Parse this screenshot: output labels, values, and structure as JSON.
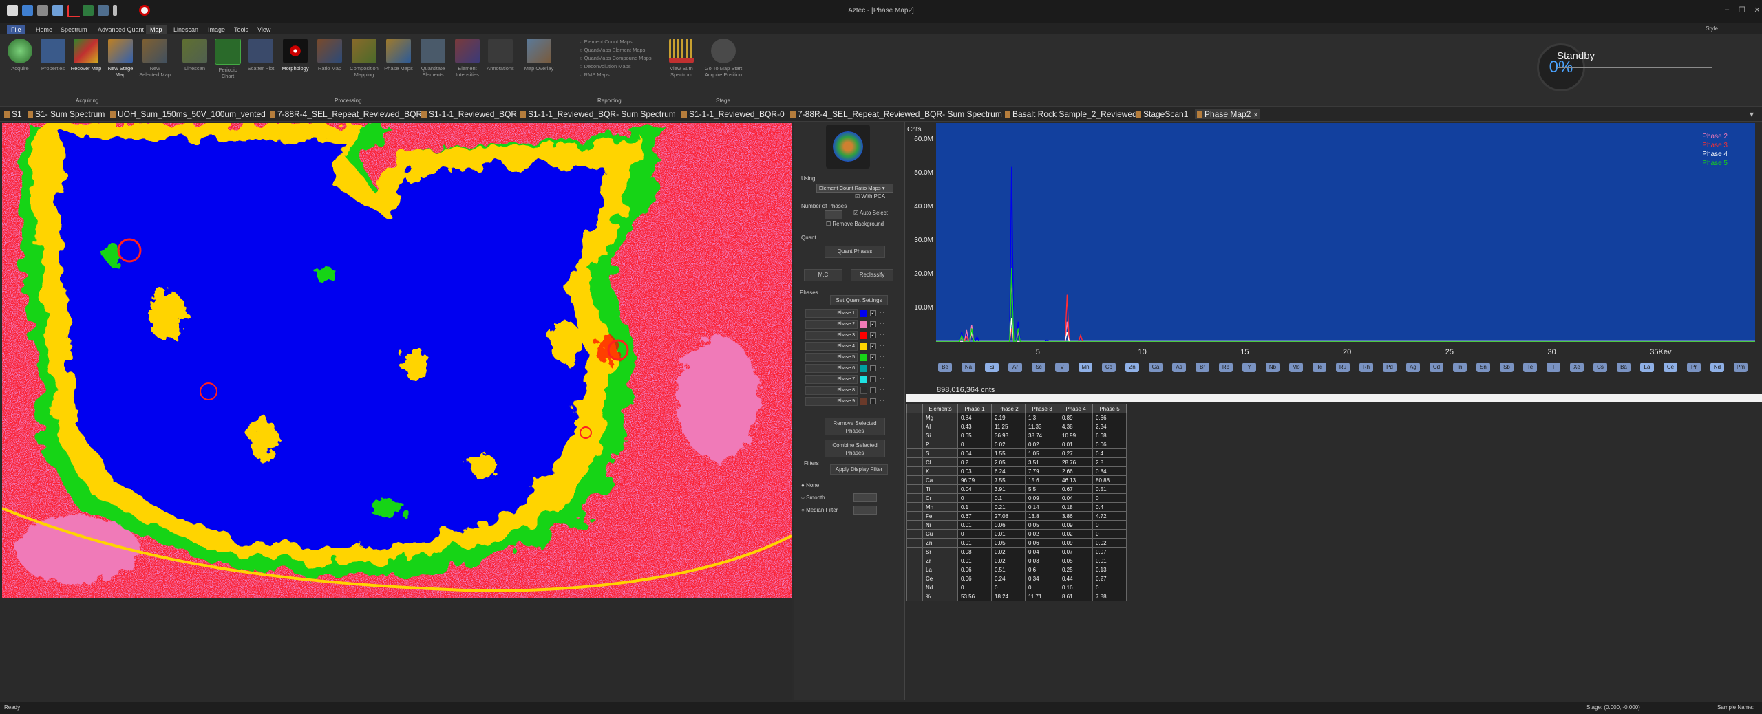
{
  "window": {
    "title": "Aztec - [Phase Map2]"
  },
  "menu": {
    "tabs": [
      "File",
      "Home",
      "Spectrum",
      "Advanced Quant",
      "Map",
      "Linescan",
      "Image",
      "Tools",
      "View"
    ],
    "active": "Map",
    "style_label": "Style"
  },
  "ribbon": {
    "groups": {
      "acquiring": "Acquiring",
      "processing": "Processing",
      "reporting": "Reporting",
      "stage": "Stage"
    },
    "buttons": [
      "Acquire",
      "Properties",
      "Recover Map",
      "New Stage Map",
      "New Selected Map",
      "Linescan",
      "Periodic Chart",
      "Scatter Plot",
      "Morphology",
      "Ratio Map",
      "Composition Mapping",
      "Phase Maps",
      "Quantitate Elements",
      "Element Intensities",
      "Annotations",
      "Map Overlay",
      "View Sum Spectrum",
      "Go To Map Start Acquire Position"
    ],
    "reporting_options": [
      "Element Count Maps",
      "QuantMaps Element Maps",
      "QuantMaps Compound Maps",
      "Deconvolution Maps",
      "RMS Maps"
    ]
  },
  "progress": {
    "percent": "0%",
    "status": "Standby"
  },
  "doc_tabs": [
    "S1",
    "S1- Sum Spectrum",
    "UOH_Sum_150ms_50V_100um_vented",
    "7-88R-4_SEL_Repeat_Reviewed_BQR",
    "S1-1-1_Reviewed_BQR",
    "S1-1-1_Reviewed_BQR- Sum Spectrum",
    "S1-1-1_Reviewed_BQR-0",
    "7-88R-4_SEL_Repeat_Reviewed_BQR- Sum Spectrum",
    "Basalt Rock Sample_2_Reviewed",
    "StageScan1",
    "Phase Map2"
  ],
  "active_doc_tab": "Phase Map2",
  "colors": {
    "phase1": "#0000f0",
    "phase2": "#f07ab8",
    "phase3": "#ff0000",
    "phase4": "#ffd400",
    "phase5": "#18d418",
    "phase6": "#00c8c8",
    "spectrum_bg": "#12409e"
  },
  "panel": {
    "using_label": "Using",
    "using_value": "Element Count Ratio Maps",
    "with_pca": "With PCA",
    "num_phases_label": "Number of Phases",
    "auto_select": "Auto Select",
    "remove_background": "Remove Background",
    "quant_label": "Quant",
    "quant_phases": "Quant Phases",
    "mc": "M.C",
    "reclassify": "Reclassify",
    "phases_label": "Phases",
    "set_quant_settings": "Set Quant Settings",
    "phases": [
      {
        "name": "Phase 1",
        "checked": "✓",
        "color": "#0000f0"
      },
      {
        "name": "Phase 2",
        "checked": "✓",
        "color": "#f07ab8"
      },
      {
        "name": "Phase 3",
        "checked": "✓",
        "color": "#ff0000"
      },
      {
        "name": "Phase 4",
        "checked": "✓",
        "color": "#ffd400"
      },
      {
        "name": "Phase 5",
        "checked": "✓",
        "color": "#18d418"
      },
      {
        "name": "Phase 6",
        "checked": "",
        "color": "#00a0a0"
      },
      {
        "name": "Phase 7",
        "checked": "",
        "color": "#1ee0e0"
      },
      {
        "name": "Phase 8",
        "checked": "",
        "color": "#2a2a2a"
      },
      {
        "name": "Phase 9",
        "checked": "",
        "color": "#6a3a2a"
      }
    ],
    "remove_selected": "Remove Selected Phases",
    "combine_selected": "Combine Selected Phases",
    "filters_label": "Filters",
    "apply_display_filter": "Apply Display Filter",
    "filter_none": "None",
    "filter_smooth": "Smooth",
    "filter_median": "Median Filter"
  },
  "spectrum": {
    "y_unit": "Cnts",
    "y_ticks": [
      "60.0M",
      "50.0M",
      "40.0M",
      "30.0M",
      "20.0M",
      "10.0M"
    ],
    "x_ticks": [
      "5",
      "10",
      "15",
      "20",
      "25",
      "30",
      "35Kev"
    ],
    "legend": [
      {
        "name": "Phase 2",
        "color": "#f07ab8"
      },
      {
        "name": "Phase 3",
        "color": "#ff3030"
      },
      {
        "name": "Phase 4",
        "color": "#ffffff"
      },
      {
        "name": "Phase 5",
        "color": "#18d418"
      }
    ],
    "elements": [
      "Be",
      "Na",
      "Si",
      "Ar",
      "Sc",
      "V",
      "Mn",
      "Co",
      "Zn",
      "Ga",
      "As",
      "Br",
      "Rb",
      "Y",
      "Nb",
      "Mo",
      "Tc",
      "Ru",
      "Rh",
      "Pd",
      "Ag",
      "Cd",
      "In",
      "Sn",
      "Sb",
      "Te",
      "I",
      "Xe",
      "Cs",
      "Ba",
      "La",
      "Ce",
      "Pr",
      "Nd",
      "Pm"
    ],
    "selected_elements": [
      "Si",
      "Mn",
      "Zn",
      "La",
      "Ce",
      "Nd"
    ],
    "counts": "898,016,364 cnts"
  },
  "chart_data": {
    "type": "line",
    "xlabel": "Kev",
    "ylabel": "Cnts",
    "xlim": [
      0,
      40
    ],
    "ylim": [
      0,
      65000000
    ],
    "series": [
      {
        "name": "Phase 1",
        "color": "#0000f0",
        "x": [
          1.25,
          1.49,
          1.74,
          2.0,
          3.69,
          4.01,
          5.41,
          6.4,
          7.06
        ],
        "y": [
          3000000,
          2000000,
          3000000,
          1500000,
          52000000,
          6000000,
          500000,
          14000000,
          1500000
        ]
      },
      {
        "name": "Phase 2",
        "color": "#f07ab8",
        "x": [
          1.25,
          1.49,
          1.74,
          3.69,
          4.01,
          6.4
        ],
        "y": [
          1500000,
          3500000,
          5000000,
          20000000,
          3000000,
          6000000
        ]
      },
      {
        "name": "Phase 3",
        "color": "#ff3030",
        "x": [
          1.49,
          1.74,
          3.69,
          6.4,
          7.06
        ],
        "y": [
          1500000,
          2500000,
          4000000,
          14000000,
          2000000
        ]
      },
      {
        "name": "Phase 4",
        "color": "#ffffff",
        "x": [
          1.74,
          3.69,
          6.4
        ],
        "y": [
          3000000,
          7000000,
          3000000
        ]
      },
      {
        "name": "Phase 5",
        "color": "#18d418",
        "x": [
          1.25,
          1.74,
          3.69,
          4.01
        ],
        "y": [
          2000000,
          4000000,
          22000000,
          4000000
        ]
      }
    ]
  },
  "table": {
    "columns": [
      "Elements",
      "Phase 1",
      "Phase 2",
      "Phase 3",
      "Phase 4",
      "Phase 5"
    ],
    "rows": [
      [
        "Mg",
        "0.84",
        "2.19",
        "1.3",
        "0.89",
        "0.66"
      ],
      [
        "Al",
        "0.43",
        "11.25",
        "11.33",
        "4.38",
        "2.34"
      ],
      [
        "Si",
        "0.65",
        "36.93",
        "38.74",
        "10.99",
        "6.68"
      ],
      [
        "P",
        "0",
        "0.02",
        "0.02",
        "0.01",
        "0.06"
      ],
      [
        "S",
        "0.04",
        "1.55",
        "1.05",
        "0.27",
        "0.4"
      ],
      [
        "Cl",
        "0.2",
        "2.05",
        "3.51",
        "28.76",
        "2.8"
      ],
      [
        "K",
        "0.03",
        "6.24",
        "7.79",
        "2.66",
        "0.84"
      ],
      [
        "Ca",
        "96.79",
        "7.55",
        "15.6",
        "46.13",
        "80.88"
      ],
      [
        "Ti",
        "0.04",
        "3.91",
        "5.5",
        "0.67",
        "0.51"
      ],
      [
        "Cr",
        "0",
        "0.1",
        "0.09",
        "0.04",
        "0"
      ],
      [
        "Mn",
        "0.1",
        "0.21",
        "0.14",
        "0.18",
        "0.4"
      ],
      [
        "Fe",
        "0.67",
        "27.08",
        "13.8",
        "3.86",
        "4.72"
      ],
      [
        "Ni",
        "0.01",
        "0.06",
        "0.05",
        "0.09",
        "0"
      ],
      [
        "Cu",
        "0",
        "0.01",
        "0.02",
        "0.02",
        "0"
      ],
      [
        "Zn",
        "0.01",
        "0.05",
        "0.06",
        "0.09",
        "0.02"
      ],
      [
        "Sr",
        "0.08",
        "0.02",
        "0.04",
        "0.07",
        "0.07"
      ],
      [
        "Zr",
        "0.01",
        "0.02",
        "0.03",
        "0.05",
        "0.01"
      ],
      [
        "La",
        "0.06",
        "0.51",
        "0.6",
        "0.25",
        "0.13"
      ],
      [
        "Ce",
        "0.06",
        "0.24",
        "0.34",
        "0.44",
        "0.27"
      ],
      [
        "Nd",
        "0",
        "0",
        "0",
        "0.16",
        "0"
      ],
      [
        "%",
        "53.56",
        "18.24",
        "11.71",
        "8.61",
        "7.88"
      ]
    ]
  },
  "status": {
    "left": "Ready",
    "stage": "Stage: (0.000, -0.000)",
    "sample": "Sample Name:"
  }
}
